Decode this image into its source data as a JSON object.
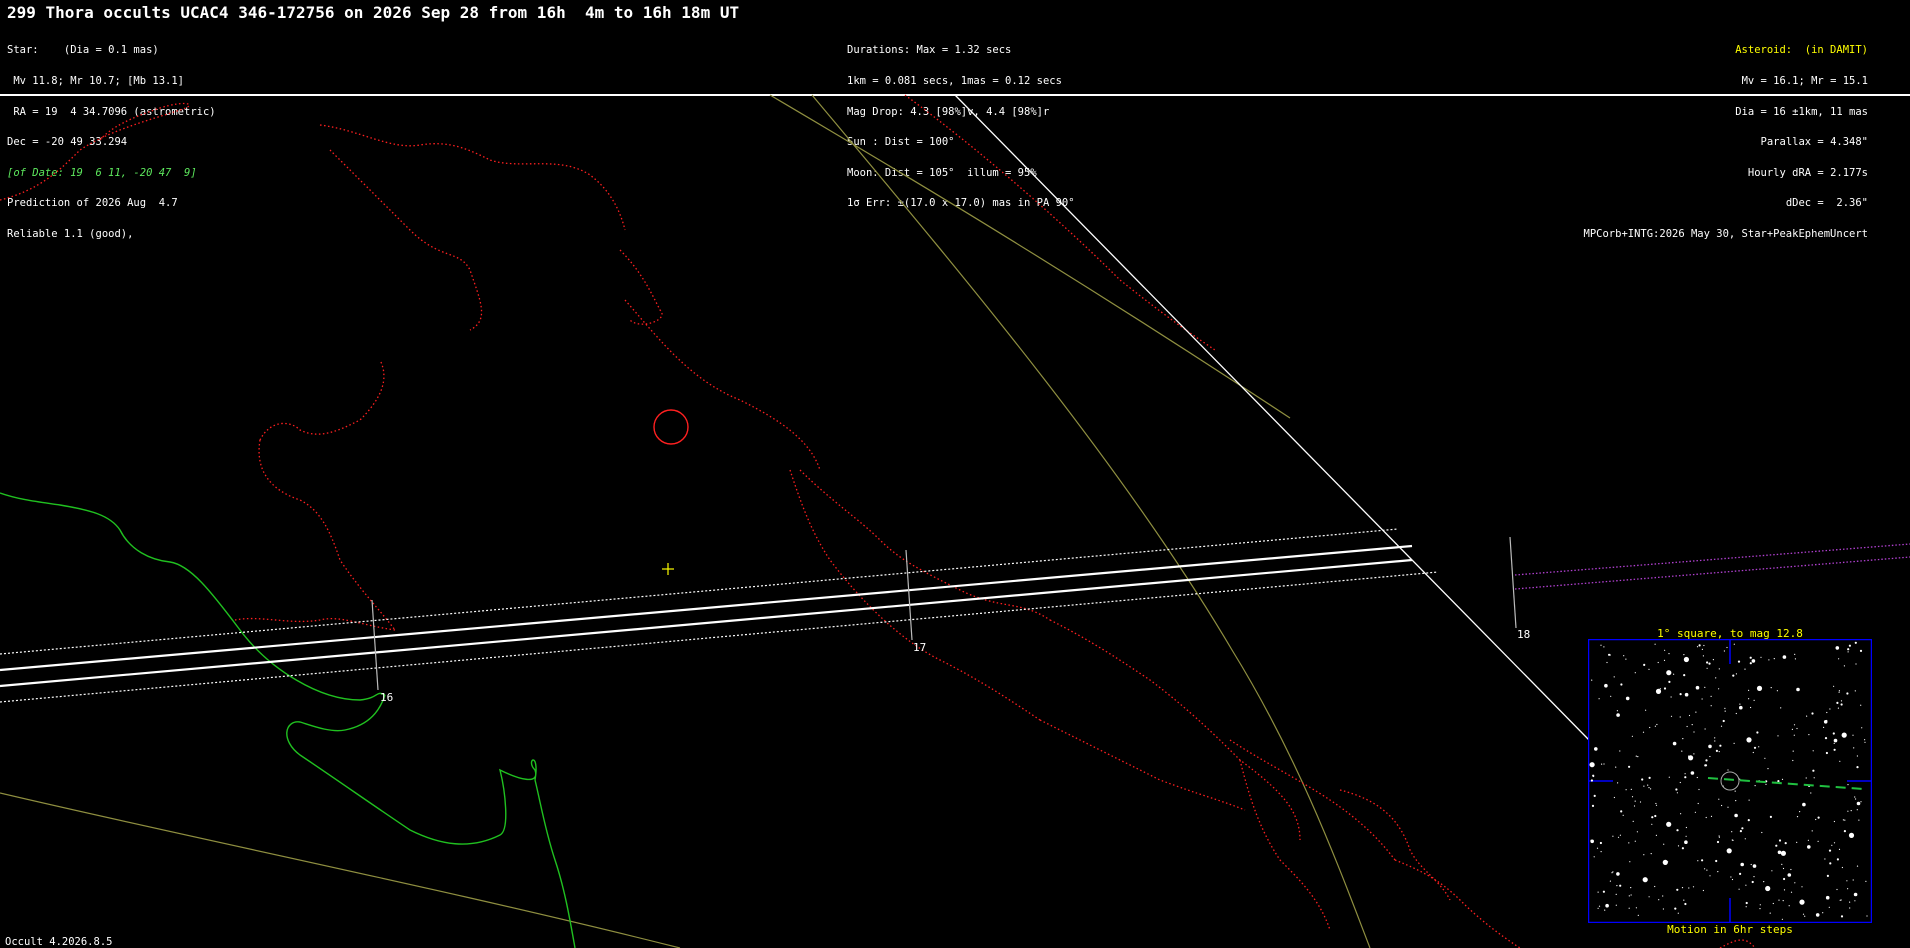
{
  "header": {
    "title": "299 Thora occults UCAC4 346-172756 on 2026 Sep 28 from 16h  4m to 16h 18m UT",
    "left_lines": [
      "Star:    (Dia = 0.1 mas)",
      " Mv 11.8; Mr 10.7; [Mb 13.1]",
      " RA = 19  4 34.7096 (astrometric)",
      "Dec = -20 49 33.294",
      "[of Date: 19  6 11, -20 47  9]",
      "Prediction of 2026 Aug  4.7",
      "Reliable 1.1 (good),"
    ],
    "middle_lines": [
      "Durations: Max = 1.32 secs",
      "1km = 0.081 secs, 1mas = 0.12 secs",
      "Mag Drop: 4.3 [98%]v, 4.4 [98%]r",
      "Sun : Dist = 100°",
      "Moon: Dist = 105°  illum = 95%",
      "1σ Err: ±(17.0 x 17.0) mas in PA 90°"
    ],
    "right_lines": [
      "Asteroid:  (in DAMIT)",
      "Mv = 16.1; Mr = 15.1",
      "Dia = 16 ±1km, 11 mas",
      "Parallax = 4.348\"",
      "Hourly dRA = 2.177s",
      "dDec =  2.36\"",
      "MPCorb+INTG:2026 May 30, Star+PeakEphemUncert"
    ]
  },
  "map": {
    "time_ticks": [
      "16",
      "17",
      "18"
    ]
  },
  "inset": {
    "title": "1° square, to mag 12.8",
    "caption": "Motion in 6hr steps"
  },
  "footer": {
    "version": "Occult 4.2026.8.5"
  },
  "colors": {
    "background": "#000000",
    "path_lines": "#ffffff",
    "border_lines": "#ff2020",
    "coastline": "#20c020",
    "latitude_lines": "#8f8f40",
    "inset_frame": "#0000ff",
    "labels_yellow": "#ffff00"
  }
}
